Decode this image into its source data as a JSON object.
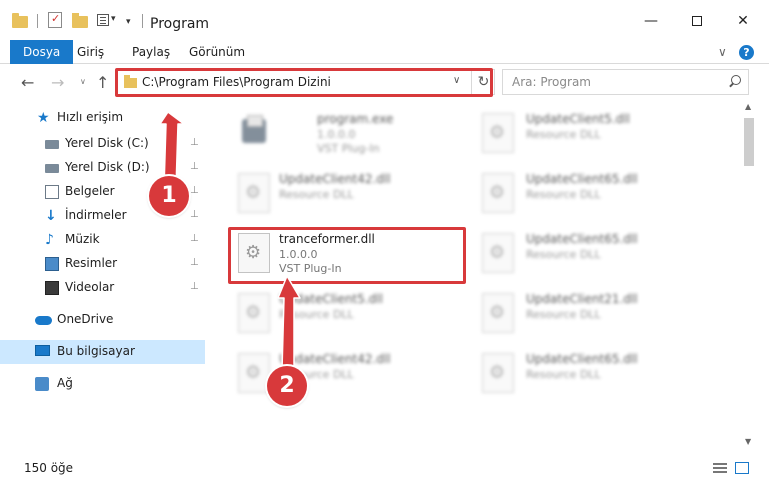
{
  "window": {
    "title": "Program",
    "minimize": "—",
    "close": "✕"
  },
  "ribbon": {
    "tabs": [
      "Dosya",
      "Giriş",
      "Paylaş",
      "Görünüm"
    ],
    "expand": "∨",
    "help": "?"
  },
  "nav": {
    "back": "←",
    "forward": "→",
    "history": "∨",
    "up": "↑",
    "address": "C:\\Program Files\\Program Dizini",
    "address_dropdown": "∨",
    "refresh": "↻",
    "search_placeholder": "Ara: Program"
  },
  "sidebar": {
    "items": [
      {
        "label": "Hızlı erişim",
        "icon": "star-icon",
        "pinned": false
      },
      {
        "label": "Yerel Disk (C:)",
        "icon": "disk-icon",
        "pinned": true
      },
      {
        "label": "Yerel Disk (D:)",
        "icon": "disk-icon",
        "pinned": true
      },
      {
        "label": "Belgeler",
        "icon": "documents-icon",
        "pinned": true
      },
      {
        "label": "İndirmeler",
        "icon": "download-icon",
        "pinned": true
      },
      {
        "label": "Müzik",
        "icon": "music-icon",
        "pinned": true
      },
      {
        "label": "Resimler",
        "icon": "pictures-icon",
        "pinned": true
      },
      {
        "label": "Videolar",
        "icon": "videos-icon",
        "pinned": true
      },
      {
        "label": "OneDrive",
        "icon": "onedrive-icon",
        "pinned": false
      },
      {
        "label": "Bu bilgisayar",
        "icon": "computer-icon",
        "pinned": false,
        "selected": true
      },
      {
        "label": "Ağ",
        "icon": "network-icon",
        "pinned": false
      }
    ],
    "pin_glyph": "📌"
  },
  "files": [
    {
      "name": "program.exe",
      "line1": "1.0.0.0",
      "line2": "VST Plug-In",
      "blurred": true
    },
    {
      "name": "UpdateClient5.dll",
      "line1": "Resource DLL",
      "line2": "",
      "blurred": true
    },
    {
      "name": "UpdateClient42.dll",
      "line1": "Resource DLL",
      "line2": "",
      "blurred": true
    },
    {
      "name": "UpdateClient65.dll",
      "line1": "Resource DLL",
      "line2": "",
      "blurred": true
    },
    {
      "name": "tranceformer.dll",
      "line1": "1.0.0.0",
      "line2": "VST Plug-In",
      "blurred": false
    },
    {
      "name": "UpdateClient65.dll",
      "line1": "Resource DLL",
      "line2": "",
      "blurred": true
    },
    {
      "name": "UpdateClient5.dll",
      "line1": "Resource DLL",
      "line2": "",
      "blurred": true
    },
    {
      "name": "UpdateClient21.dll",
      "line1": "Resource DLL",
      "line2": "",
      "blurred": true
    },
    {
      "name": "UpdateClient42.dll",
      "line1": "Resource DLL",
      "line2": "",
      "blurred": true
    },
    {
      "name": "UpdateClient65.dll",
      "line1": "Resource DLL",
      "line2": "",
      "blurred": true
    }
  ],
  "status": {
    "item_count": "150 öğe"
  },
  "annotations": {
    "badge1": "1",
    "badge2": "2",
    "color": "#d8393b"
  },
  "colors": {
    "accent": "#1979ca",
    "selection": "#cce8ff"
  }
}
